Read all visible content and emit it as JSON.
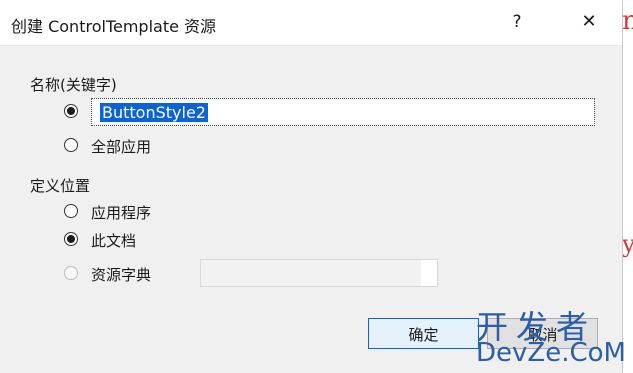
{
  "window": {
    "title": "创建 ControlTemplate 资源",
    "help_glyph": "?",
    "close_glyph": "✕"
  },
  "name_section": {
    "label": "名称(关键字)",
    "name_option_selected": true,
    "name_value": "ButtonStyle2",
    "apply_all_label": "全部应用"
  },
  "location_section": {
    "label": "定义位置",
    "options": [
      {
        "label": "应用程序",
        "selected": false,
        "enabled": true
      },
      {
        "label": "此文档",
        "selected": true,
        "enabled": true
      },
      {
        "label": "资源字典",
        "selected": false,
        "enabled": false
      }
    ],
    "dictionary_value": ""
  },
  "buttons": {
    "ok_label": "确定",
    "cancel_label": "取消"
  },
  "background_chars": [
    "n",
    "y"
  ],
  "watermark": {
    "top": "开发者",
    "bottom": "DevZe.CoM"
  },
  "colors": {
    "selection": "#0a64d6",
    "background_text": "#d23a3a",
    "watermark": "#2a5ea8"
  }
}
